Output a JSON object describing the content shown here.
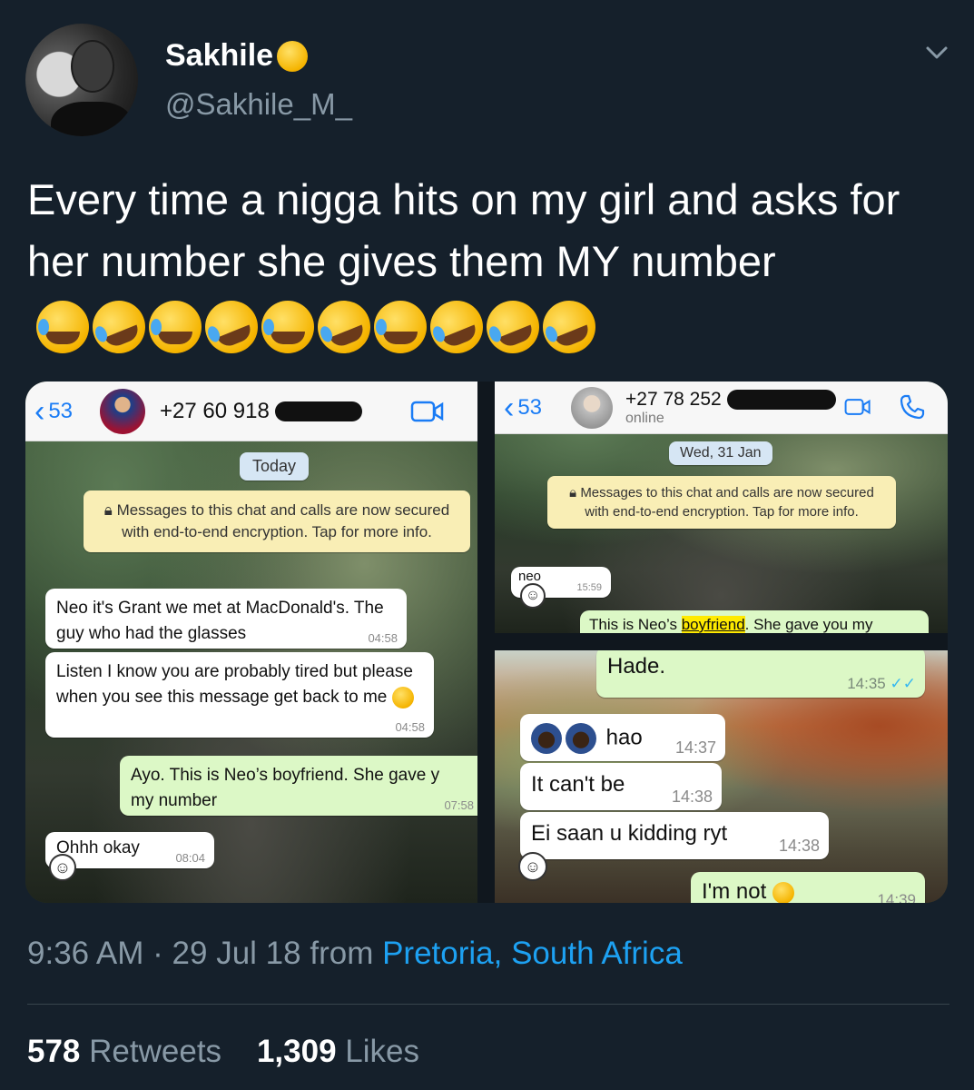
{
  "tweet": {
    "display_name": "Sakhile",
    "handle": "@Sakhile_M_",
    "text": "Every time a nigga hits on my girl and asks for her number she gives them MY number",
    "time": "9:36 AM",
    "separator": "·",
    "date": "29 Jul 18",
    "from_word": "from",
    "location": "Pretoria, South Africa",
    "retweets_count": "578",
    "retweets_label": "Retweets",
    "likes_count": "1,309",
    "likes_label": "Likes"
  },
  "chat_left": {
    "back_count": "53",
    "number": "+27 60 918",
    "date_pill": "Today",
    "notice": "Messages to this chat and calls are now secured with end-to-end encryption. Tap for more info.",
    "messages": [
      {
        "text": "Neo it's Grant we met at MacDonald's. The guy who had the glasses",
        "time": "04:58"
      },
      {
        "text": "Listen I know you are probably tired but please when you see this message get back to me",
        "time": "04:58"
      },
      {
        "text": "Ayo. This is Neo’s boyfriend. She gave y",
        "text2": "my number",
        "time": "07:58"
      },
      {
        "text": "Ohhh okay",
        "time": "08:04"
      }
    ]
  },
  "chat_top_right": {
    "back_count": "53",
    "number": "+27 78 252",
    "status": "online",
    "date_pill": "Wed, 31 Jan",
    "notice": "Messages to this chat and calls are now secured with end-to-end encryption. Tap for more info.",
    "messages": [
      {
        "text": "neo",
        "time": "15:59"
      },
      {
        "text_before": "This is Neo’s ",
        "text_highlight": "boyfriend",
        "text_after": ". She gave you my"
      }
    ]
  },
  "chat_bottom_right": {
    "messages": [
      {
        "text": "Hade.",
        "time": "14:35"
      },
      {
        "text": "hao",
        "time": "14:37"
      },
      {
        "text": "It can't be",
        "time": "14:38"
      },
      {
        "text": "Ei saan u kidding ryt",
        "time": "14:38"
      },
      {
        "text": "I'm not",
        "time": "14:39"
      }
    ]
  },
  "colors": {
    "background": "#15202b",
    "secondary_text": "#8899a6",
    "link": "#1da1f2",
    "whatsapp_blue": "#1a7cf5",
    "outgoing_bubble": "#dcf8c6",
    "notice_bg": "#f9eeb5"
  },
  "icons": {
    "name_emoji": "smirking-face-emoji",
    "text_emojis": [
      "face-with-tears-of-joy",
      "rolling-on-floor-laughing"
    ],
    "menu": "chevron-down-icon"
  }
}
